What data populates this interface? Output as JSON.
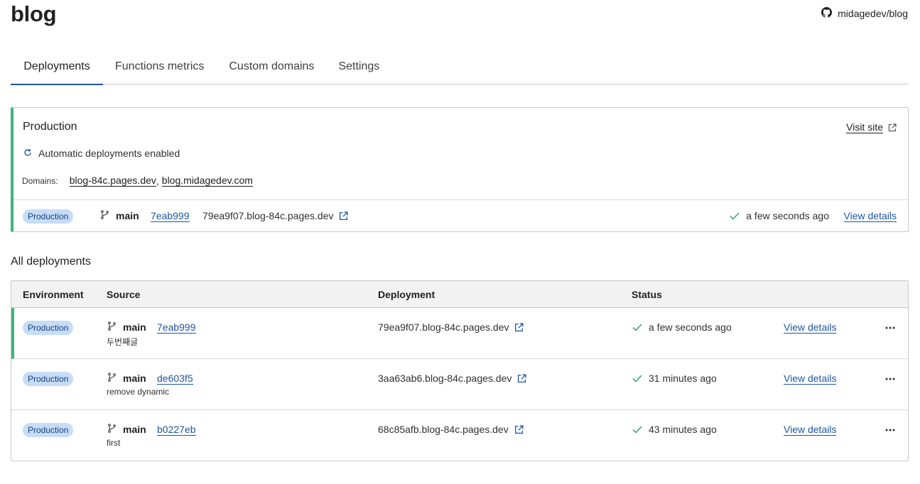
{
  "header": {
    "title": "blog",
    "repo": "midagedev/blog",
    "repo_icon": "github-icon"
  },
  "tabs": [
    {
      "label": "Deployments",
      "active": true
    },
    {
      "label": "Functions metrics",
      "active": false
    },
    {
      "label": "Custom domains",
      "active": false
    },
    {
      "label": "Settings",
      "active": false
    }
  ],
  "production": {
    "title": "Production",
    "visit_site": "Visit site",
    "auto_deploy": "Automatic deployments enabled",
    "domains_label": "Domains:",
    "domains": [
      "blog-84c.pages.dev",
      "blog.midagedev.com"
    ],
    "domain_separator": ",",
    "latest": {
      "environment": "Production",
      "branch": "main",
      "commit": "7eab999",
      "deployment": "79ea9f07.blog-84c.pages.dev",
      "status": "a few seconds ago",
      "view_details": "View details"
    }
  },
  "all_deployments": {
    "title": "All deployments",
    "columns": [
      "Environment",
      "Source",
      "Deployment",
      "Status"
    ],
    "rows": [
      {
        "environment": "Production",
        "branch": "main",
        "commit": "7eab999",
        "message": "두번째글",
        "deployment": "79ea9f07.blog-84c.pages.dev",
        "status": "a few seconds ago",
        "view_details": "View details",
        "current": true
      },
      {
        "environment": "Production",
        "branch": "main",
        "commit": "de603f5",
        "message": "remove dynamic",
        "deployment": "3aa63ab6.blog-84c.pages.dev",
        "status": "31 minutes ago",
        "view_details": "View details",
        "current": false
      },
      {
        "environment": "Production",
        "branch": "main",
        "commit": "b0227eb",
        "message": "first",
        "deployment": "68c85afb.blog-84c.pages.dev",
        "status": "43 minutes ago",
        "view_details": "View details",
        "current": false
      }
    ]
  },
  "colors": {
    "accent": "#1e56a0",
    "success": "#3fb37f",
    "badge_bg": "#c6dcf7"
  }
}
